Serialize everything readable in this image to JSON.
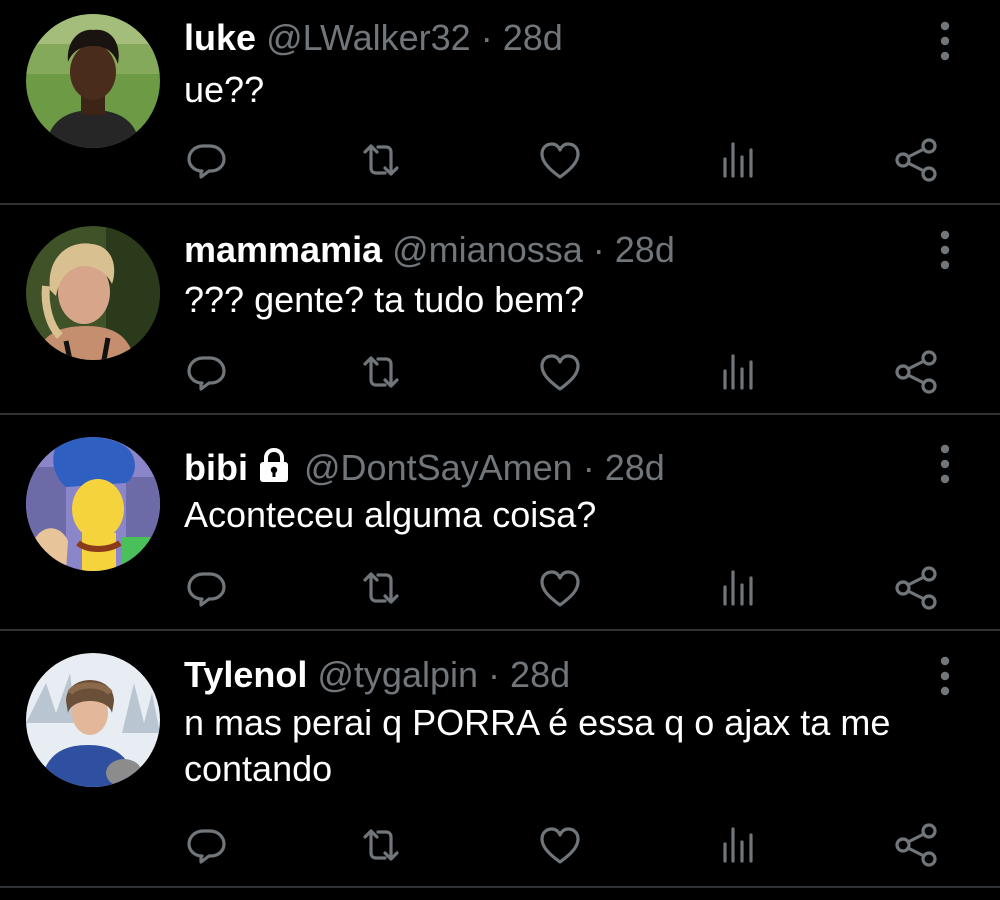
{
  "tweets": [
    {
      "name": "luke",
      "handle": "@LWalker32",
      "separator": "·",
      "time": "28d",
      "text": "ue??",
      "locked": false
    },
    {
      "name": "mammamia",
      "handle": "@mianossa",
      "separator": "·",
      "time": "28d",
      "text": "??? gente? ta tudo bem?",
      "locked": false
    },
    {
      "name": "bibi",
      "handle": "@DontSayAmen",
      "separator": "·",
      "time": "28d",
      "text": "Aconteceu alguma coisa?",
      "locked": true
    },
    {
      "name": "Tylenol",
      "handle": "@tygalpin",
      "separator": "·",
      "time": "28d",
      "text": "n mas perai q PORRA é essa q o ajax ta me contando",
      "locked": false
    }
  ],
  "icons": {
    "reply": "reply-icon",
    "retweet": "retweet-icon",
    "like": "heart-icon",
    "views": "analytics-icon",
    "share": "share-icon",
    "more": "more-vertical-icon",
    "lock": "lock-icon"
  },
  "colors": {
    "background": "#000000",
    "primary_text": "#ffffff",
    "secondary_text": "#71767b",
    "divider": "#2f3336"
  }
}
